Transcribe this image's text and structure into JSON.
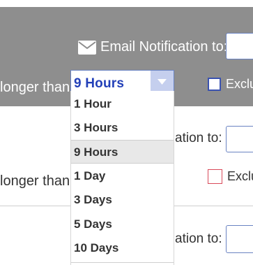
{
  "header": {
    "email_label": "Email Notification to:",
    "longer_than": "longer than",
    "exclude": "Exclu"
  },
  "frequency_select": {
    "value": "9 Hours"
  },
  "frequency_options": [
    {
      "label": "1 Hour",
      "selected": false
    },
    {
      "label": "3 Hours",
      "selected": false
    },
    {
      "label": "9 Hours",
      "selected": true
    },
    {
      "label": "1 Day",
      "selected": false
    },
    {
      "label": "3 Days",
      "selected": false
    },
    {
      "label": "5 Days",
      "selected": false
    },
    {
      "label": "10 Days",
      "selected": false
    }
  ],
  "section2": {
    "email_label": "ation to:",
    "longer_than": "longer than",
    "exclude": "Exclu"
  },
  "section3": {
    "email_label": "ation to:"
  },
  "icons": {
    "email": "envelope-icon",
    "dropdown": "chevron-down-icon"
  },
  "colors": {
    "panel": "#8e8e8e",
    "accent": "#2340b8",
    "selected_option_bg": "#e8e8e8",
    "checkbox_red": "#d94a5a"
  }
}
